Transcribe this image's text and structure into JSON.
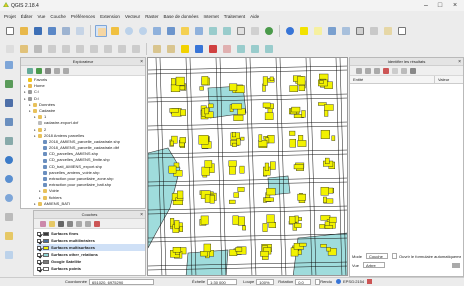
{
  "window": {
    "title": "QGIS 2.18.4",
    "minimize": "–",
    "maximize": "□",
    "close": "×"
  },
  "menu": [
    "Projet",
    "Éditer",
    "Vue",
    "Couche",
    "Préférences",
    "Extension",
    "Vecteur",
    "Raster",
    "Base de données",
    "Internet",
    "Traitement",
    "Aide"
  ],
  "browser": {
    "title": "Explorateur",
    "items": [
      {
        "label": "Favoris",
        "icon": "star-icon",
        "indent": 0
      },
      {
        "label": "Home",
        "icon": "home-folder-icon",
        "indent": 0
      },
      {
        "label": "C:\\",
        "icon": "drive-icon",
        "indent": 0
      },
      {
        "label": "D:\\",
        "icon": "drive-icon",
        "indent": 0
      },
      {
        "label": "Données",
        "icon": "folder-icon",
        "indent": 1
      },
      {
        "label": "Cadastre",
        "icon": "folder-icon",
        "indent": 1
      },
      {
        "label": "1",
        "icon": "folder-icon",
        "indent": 2
      },
      {
        "label": "cadastre-export.dxf",
        "icon": "file-icon",
        "indent": 2
      },
      {
        "label": "2",
        "icon": "folder-icon",
        "indent": 2
      },
      {
        "label": "2018 Amiens parcelles",
        "icon": "folder-icon",
        "indent": 2
      },
      {
        "label": "2018_AMIENS_parcelle_cadastrale.shp",
        "icon": "vector-file-icon",
        "indent": 3
      },
      {
        "label": "2018_AMIENS_parcelle_cadastrale.dbf",
        "icon": "vector-file-icon",
        "indent": 3
      },
      {
        "label": "CD_parcelles_AMIENS.shp",
        "icon": "vector-file-icon",
        "indent": 3
      },
      {
        "label": "CD_parcelles_AMIENS_limite.shp",
        "icon": "vector-file-icon",
        "indent": 3
      },
      {
        "label": "CD_bati_AMIENS_export.shp",
        "icon": "vector-file-icon",
        "indent": 3
      },
      {
        "label": "parcelles_amiens_voirie.shp",
        "icon": "vector-file-icon",
        "indent": 3
      },
      {
        "label": "extraction pour parcellaire_zone.shp",
        "icon": "vector-file-icon",
        "indent": 3
      },
      {
        "label": "extraction pour parcellaire_bati.shp",
        "icon": "vector-file-icon",
        "indent": 3
      },
      {
        "label": "Voirie",
        "icon": "folder-icon",
        "indent": 3
      },
      {
        "label": "fichiers",
        "icon": "folder-icon",
        "indent": 3
      },
      {
        "label": "AMIENS_BATI",
        "icon": "folder-icon",
        "indent": 2
      }
    ]
  },
  "layers": {
    "title": "Couches",
    "items": [
      {
        "label": "Surfaces fines",
        "checked": true,
        "swatch": "#3a3a3a",
        "bold": true
      },
      {
        "label": "Surfaces multilinéaires",
        "checked": true,
        "swatch": "#4a6f9a",
        "bold": true
      },
      {
        "label": "Surfaces multisurfaces",
        "checked": true,
        "swatch": "#f2f200",
        "bold": true,
        "selected": true
      },
      {
        "label": "Surfaces other_relations",
        "checked": true,
        "swatch": "#8fd4d4",
        "bold": true
      },
      {
        "label": "Google Satellite",
        "checked": true,
        "swatch": "#7a7a7a",
        "bold": true
      },
      {
        "label": "Surfaces points",
        "checked": true,
        "swatch": "#ffffff",
        "bold": true
      }
    ]
  },
  "identify": {
    "title": "Identifier les résultats",
    "columns": [
      "Entité",
      "Valeur"
    ],
    "mode_label": "Mode",
    "mode_value": "Couche",
    "auto_open_label": "Ouvrir le formulaire automatiquement",
    "view_label": "Vue",
    "view_value": "Arbre"
  },
  "status": {
    "coord_label": "Coordonnée",
    "coord_value": "651020, 6975290",
    "scale_label": "Échelle",
    "scale_value": "1:30 000",
    "magnifier_label": "Loupe",
    "magnifier_value": "100%",
    "rotation_label": "Rotation",
    "rotation_value": "0.0",
    "render_label": "Rendu",
    "crs_label": "EPSG:2154"
  },
  "colors": {
    "building": "#f2f200",
    "water": "#9fdcdc",
    "road_edge": "#111111",
    "background": "#ffffff",
    "accent": "#3875d7"
  }
}
